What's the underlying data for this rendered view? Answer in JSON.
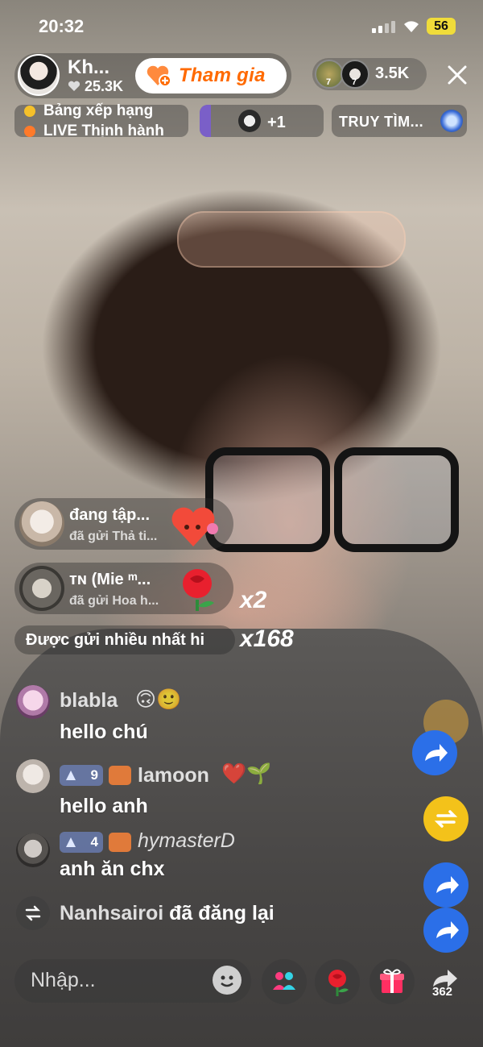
{
  "status_bar": {
    "time": "20:32",
    "battery": "56"
  },
  "host": {
    "name": "Kh...",
    "likes": "25.3K",
    "join_label": "Tham gia"
  },
  "viewers": {
    "badge_1": "7",
    "badge_2": "7",
    "count": "3.5K"
  },
  "chips": {
    "ranking_line1": "Bảng xếp hạng",
    "ranking_line2": "LIVE Thịnh hành",
    "plus_count": "+1",
    "search_label": "TRUY TÌM..."
  },
  "gifts": [
    {
      "name": "đang tập...",
      "sub": "đã gửi Thả ti...",
      "count": ""
    },
    {
      "name": "ᴛɴ (Mie ᵐ...",
      "sub": "đã gửi Hoa h...",
      "count": "x2"
    }
  ],
  "most_sent": {
    "label": "Được gửi nhiều nhất hi",
    "count": "x168"
  },
  "comments": [
    {
      "user": "blabla",
      "level": "",
      "emoji": "🙃🙂",
      "message": "hello chú"
    },
    {
      "user": "lamoon",
      "level": "9",
      "emoji": "❤️🌱",
      "message": "hello anh"
    },
    {
      "user": "hymasterD",
      "level": "4",
      "emoji": "",
      "message": "anh ăn chx"
    }
  ],
  "repost": {
    "user": "Nanhsairoi",
    "text": "đã đăng lại"
  },
  "bottom_bar": {
    "placeholder": "Nhập...",
    "share_count": "362"
  },
  "colors": {
    "accent_orange": "#ff6a00",
    "battery_yellow": "#f0dc3a",
    "repost_yellow": "#f3c21a",
    "share_blue": "#2b6fe8"
  }
}
